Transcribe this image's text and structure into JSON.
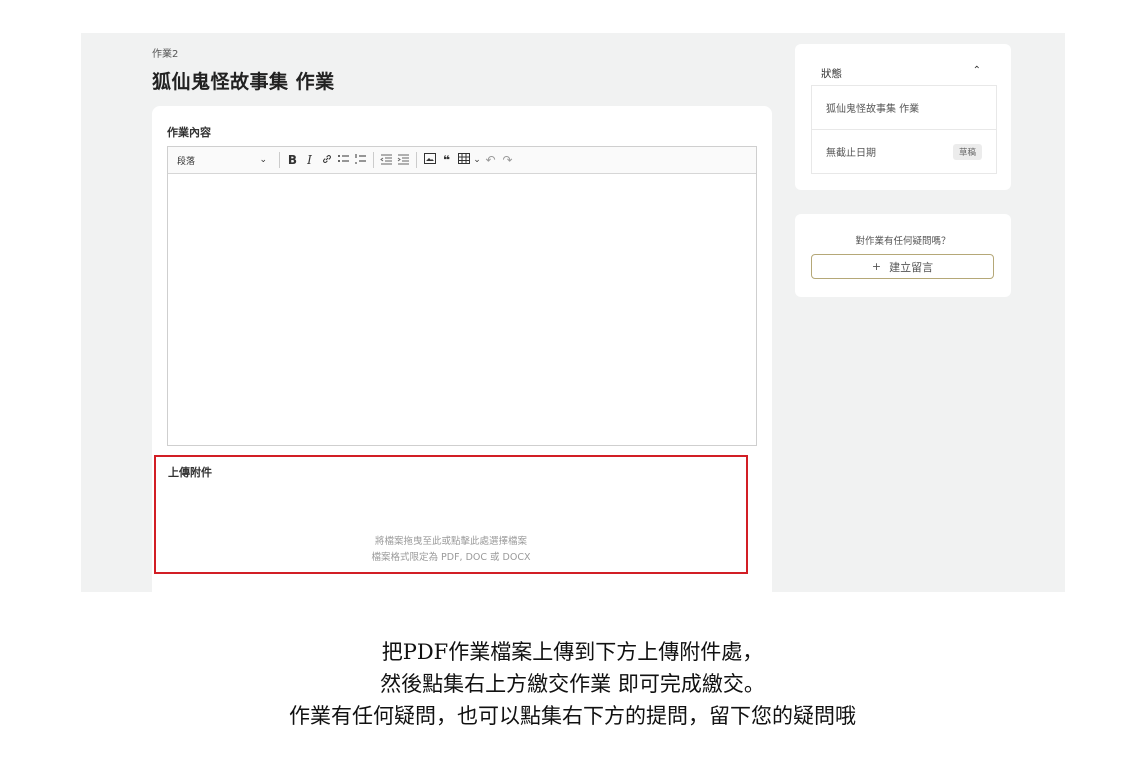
{
  "header": {
    "breadcrumb": "作業2",
    "title": "狐仙鬼怪故事集 作業"
  },
  "editor": {
    "label": "作業內容",
    "paragraph_select": "段落",
    "toolbar_icons": [
      "bold-icon",
      "italic-icon",
      "link-icon",
      "bulleted-list-icon",
      "numbered-list-icon",
      "outdent-icon",
      "indent-icon",
      "image-icon",
      "quote-icon",
      "table-icon",
      "undo-icon",
      "redo-icon"
    ]
  },
  "upload": {
    "label": "上傳附件",
    "drop_hint": "將檔案拖曳至此或點擊此處選擇檔案",
    "format_hint": "檔案格式限定為 PDF, DOC 或 DOCX",
    "highlight_color": "#d21e25"
  },
  "status_panel": {
    "title": "狀態",
    "assignment_name": "狐仙鬼怪故事集 作業",
    "deadline": "無截止日期",
    "badge": "草稿"
  },
  "question_panel": {
    "question": "對作業有任何疑問嗎？",
    "button_label": "建立留言"
  },
  "caption": {
    "line1": "把PDF作業檔案上傳到下方上傳附件處，",
    "line2": "然後點集右上方繳交作業 即可完成繳交。",
    "line3": "作業有任何疑問，也可以點集右下方的提問，留下您的疑問哦"
  },
  "colors": {
    "accent_border": "#b5a878",
    "screen_bg": "#f1f2f2"
  }
}
